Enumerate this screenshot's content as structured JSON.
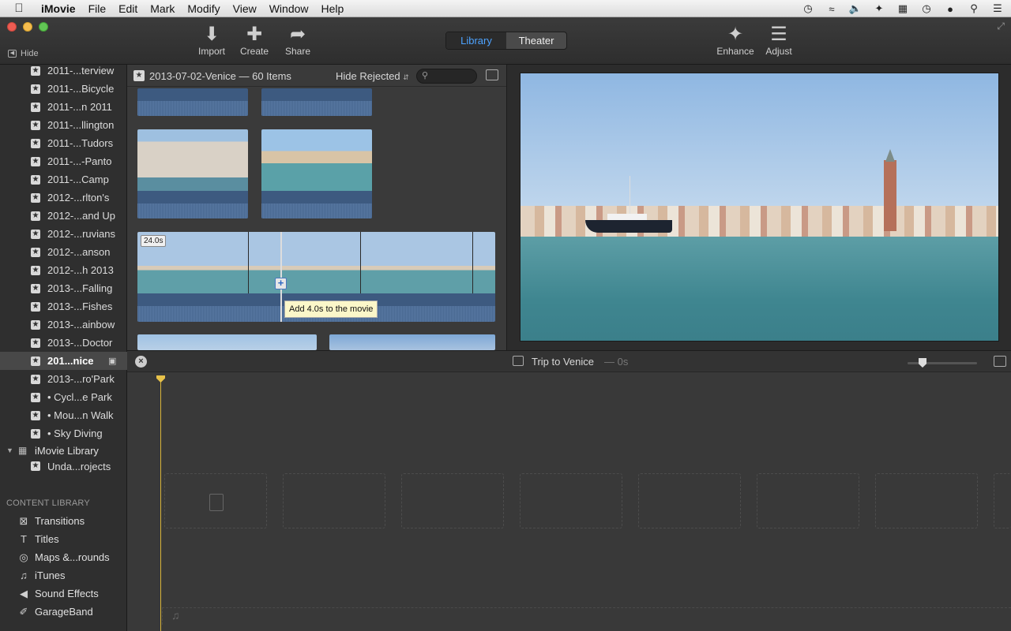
{
  "menubar": {
    "app_name": "iMovie",
    "menus": [
      "File",
      "Edit",
      "Mark",
      "Modify",
      "View",
      "Window",
      "Help"
    ],
    "status_icons": [
      "time-machine-icon",
      "wifi-icon",
      "volume-icon",
      "bluetooth-icon",
      "keyboard-icon",
      "clock-icon",
      "user-icon",
      "spotlight-icon",
      "notification-center-icon"
    ]
  },
  "toolbar": {
    "hide_label": "Hide",
    "import_label": "Import",
    "create_label": "Create",
    "share_label": "Share",
    "library_tab": "Library",
    "theater_tab": "Theater",
    "enhance_label": "Enhance",
    "adjust_label": "Adjust"
  },
  "sidebar": {
    "events": [
      {
        "label": "2011-...terview"
      },
      {
        "label": "2011-...Bicycle"
      },
      {
        "label": "2011-...n 2011"
      },
      {
        "label": "2011-...llington"
      },
      {
        "label": "2011-...Tudors"
      },
      {
        "label": "2011-...-Panto"
      },
      {
        "label": "2011-...Camp"
      },
      {
        "label": "2012-...rlton's"
      },
      {
        "label": "2012-...and Up"
      },
      {
        "label": "2012-...ruvians"
      },
      {
        "label": "2012-...anson"
      },
      {
        "label": "2012-...h 2013"
      },
      {
        "label": "2013-...Falling"
      },
      {
        "label": "2013-...Fishes"
      },
      {
        "label": "2013-...ainbow"
      },
      {
        "label": "2013-...Doctor"
      },
      {
        "label": "201...nice"
      },
      {
        "label": "2013-...ro'Park"
      },
      {
        "label": "• Cycl...e Park"
      },
      {
        "label": "• Mou...n Walk"
      },
      {
        "label": "• Sky Diving"
      }
    ],
    "library_label": "iMovie Library",
    "library_child": "Unda...rojects",
    "content_library_header": "CONTENT LIBRARY",
    "content_items": [
      {
        "label": "Transitions",
        "icon": "transitions-icon"
      },
      {
        "label": "Titles",
        "icon": "titles-icon"
      },
      {
        "label": "Maps &...rounds",
        "icon": "globe-icon"
      },
      {
        "label": "iTunes",
        "icon": "music-note-icon"
      },
      {
        "label": "Sound Effects",
        "icon": "speaker-icon"
      },
      {
        "label": "GarageBand",
        "icon": "guitar-icon"
      }
    ]
  },
  "browser": {
    "title": "2013-07-02-Venice — 60 Items",
    "filter": "Hide Rejected",
    "search_placeholder": "",
    "clip_duration_badge": "24.0s",
    "tooltip": "Add 4.0s to the movie"
  },
  "project": {
    "title": "Trip to Venice",
    "duration": "— 0s"
  }
}
